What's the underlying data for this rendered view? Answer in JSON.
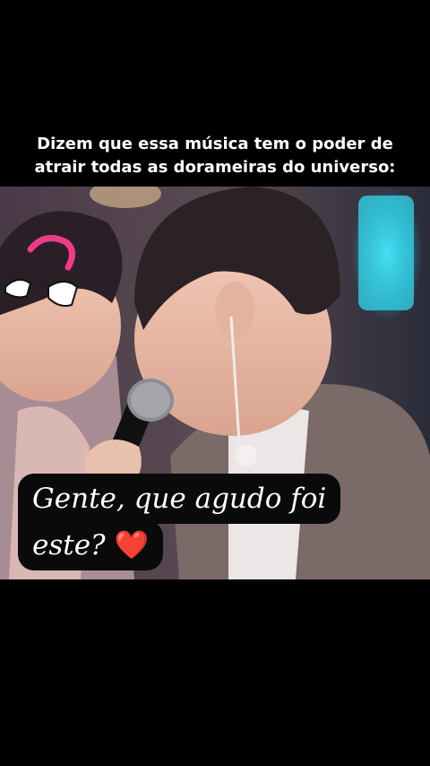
{
  "top_caption": {
    "line1": "Dizem que essa música tem o poder de",
    "line2": "atrair todas as dorameiras do universo:"
  },
  "overlay_caption": {
    "line1": "Gente, que agudo foi",
    "line2": "este?",
    "emoji": "❤️"
  },
  "colors": {
    "background": "#000000",
    "caption_text": "#ffffff",
    "heart": "#e0192e",
    "sticker_pink": "#ef3b8a"
  },
  "icons": [
    "pointing-hands-sticker",
    "pink-curved-arrow-sticker",
    "heart-emoji"
  ]
}
